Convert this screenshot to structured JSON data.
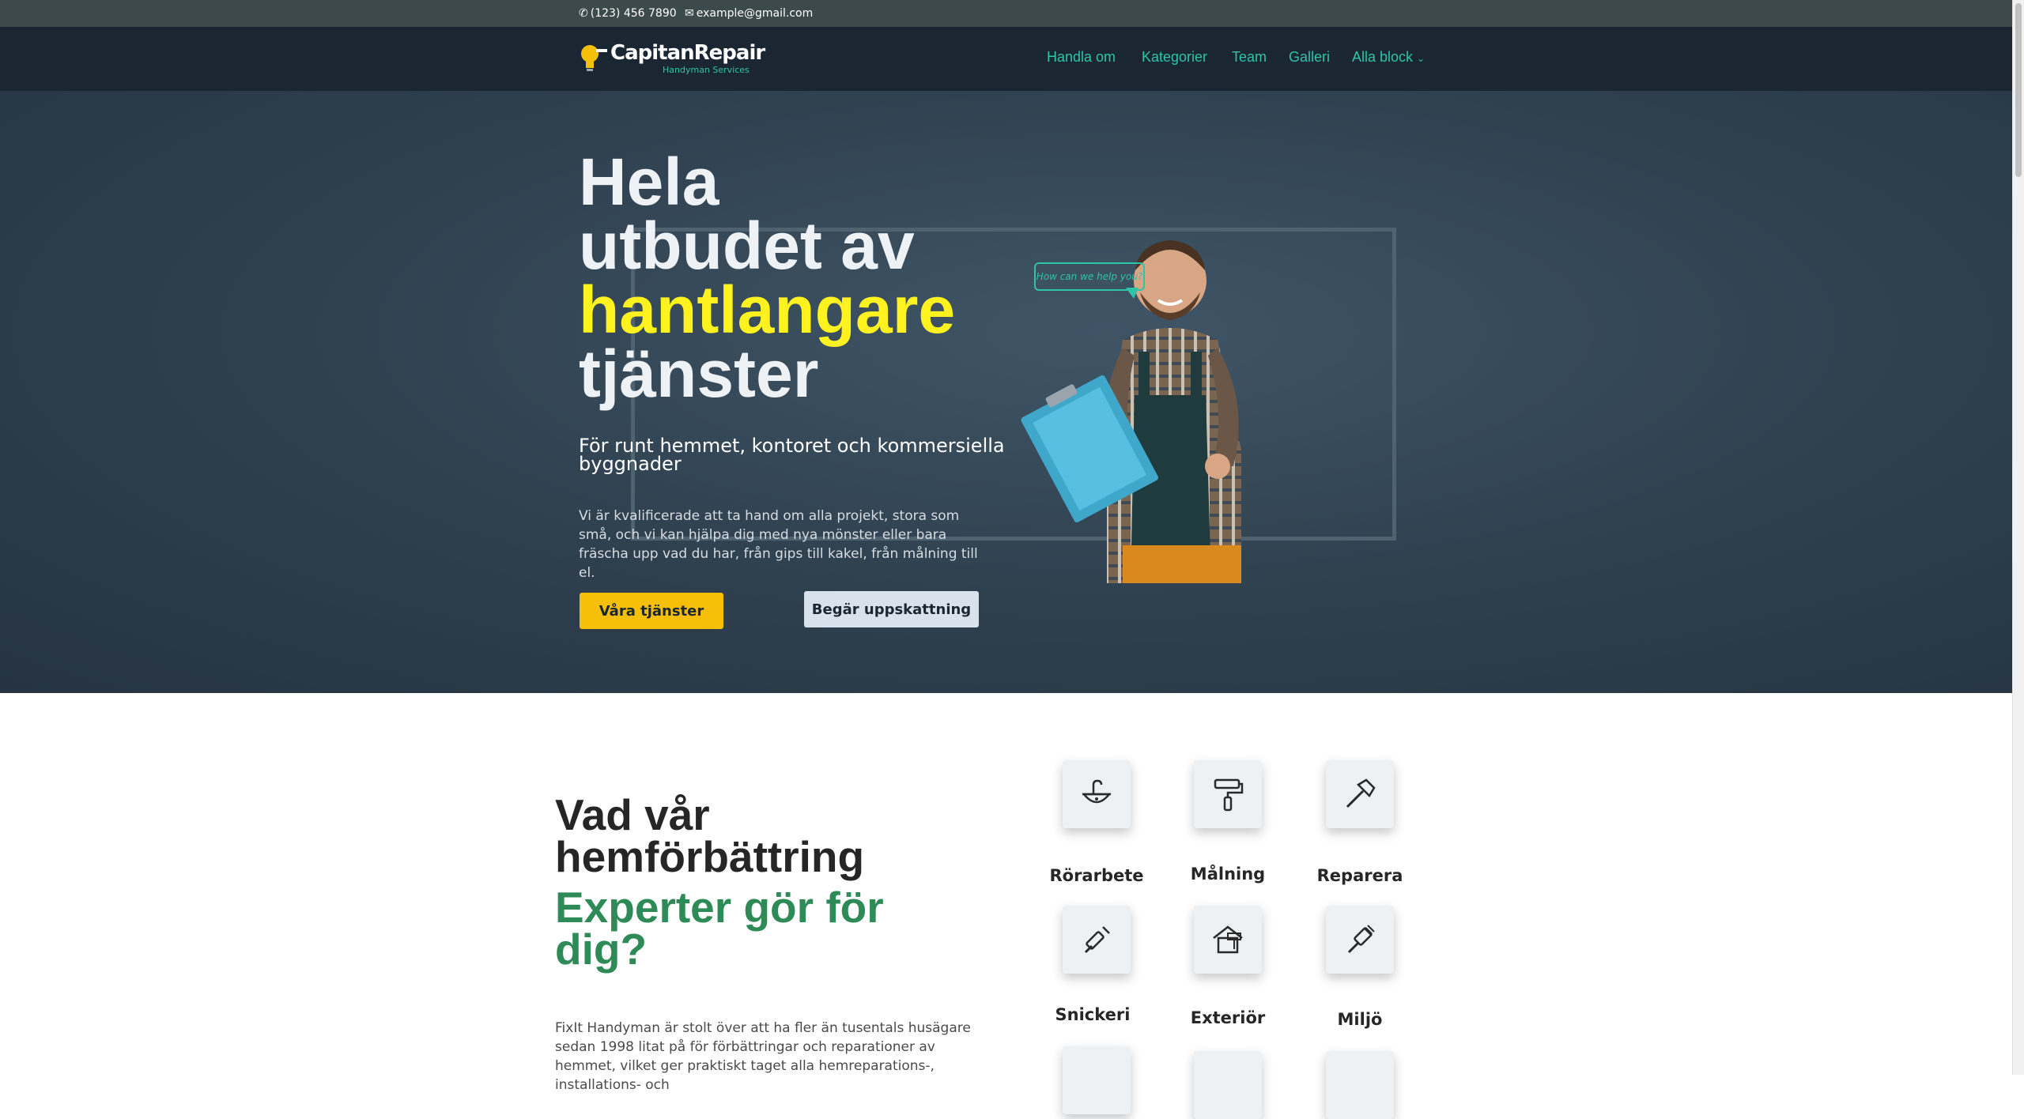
{
  "topbar": {
    "phone": "(123) 456 7890",
    "email": "example@gmail.com"
  },
  "header": {
    "logo_name": "CapitanRepair",
    "logo_sub": "Handyman Services",
    "nav": [
      {
        "label": "Handla om"
      },
      {
        "label": "Kategorier"
      },
      {
        "label": "Team"
      },
      {
        "label": "Galleri"
      },
      {
        "label": "Alla block"
      }
    ]
  },
  "hero": {
    "title_line1": "Hela",
    "title_line2": "utbudet av",
    "title_highlight": "hantlangare",
    "title_line4": "tjänster",
    "subtitle": "För runt hemmet, kontoret och kommersiella byggnader",
    "text": "Vi är kvalificerade att ta hand om alla projekt, stora som små, och vi kan hjälpa dig med nya mönster eller bara fräscha upp vad du har, från gips till kakel, från målning till el.",
    "primary_button": "Våra tjänster",
    "secondary_button": "Begär uppskattning",
    "speech_bubble": "How can we help you?"
  },
  "services_section": {
    "title": "Vad vår hemförbättring",
    "title_accent": "Experter gör för dig?",
    "text": "FixIt Handyman är stolt över att ha fler än tusentals husägare sedan 1998 litat på för förbättringar och reparationer av hemmet, vilket ger praktiskt taget alla hemreparations-, installations- och",
    "services": [
      {
        "label": "Rörarbete",
        "icon": "sink-icon"
      },
      {
        "label": "Målning",
        "icon": "paint-roller-icon"
      },
      {
        "label": "Reparera",
        "icon": "hammer-icon"
      },
      {
        "label": "Snickeri",
        "icon": "chisel-icon"
      },
      {
        "label": "Exteriör",
        "icon": "house-paint-icon"
      },
      {
        "label": "Miljö",
        "icon": "brush-icon"
      }
    ]
  },
  "colors": {
    "accent_teal": "#2ec4a6",
    "highlight_yellow": "#fff21f",
    "button_yellow": "#f5bf0a",
    "accent_green": "#2e8b57",
    "nav_bg": "#1b2633"
  }
}
